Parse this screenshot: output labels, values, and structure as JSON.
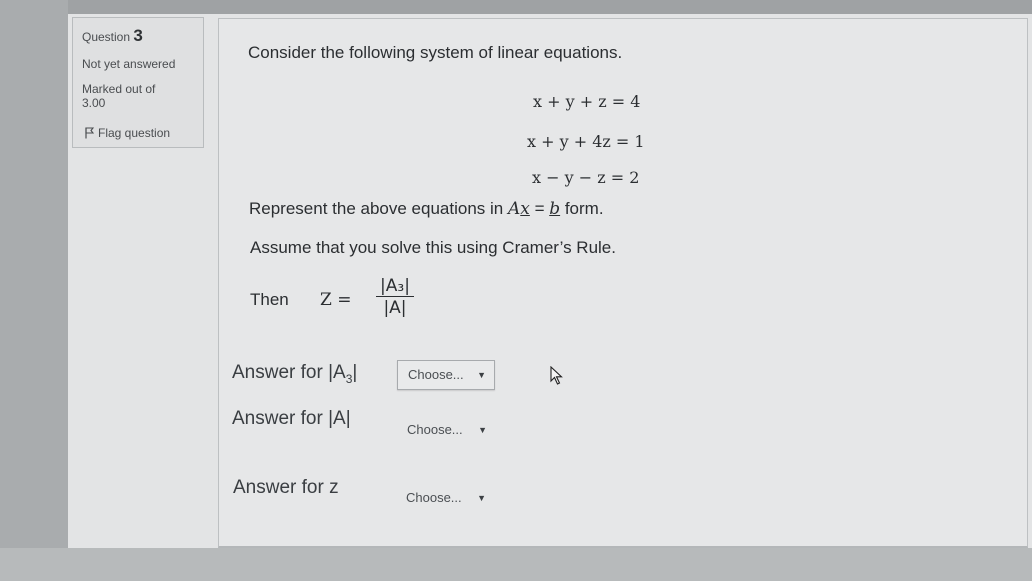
{
  "info": {
    "question_prefix": "Question",
    "question_number": "3",
    "state": "Not yet answered",
    "marked_out_of_label": "Marked out of",
    "marked_out_of_value": "3.00",
    "flag_label": "Flag question"
  },
  "question": {
    "intro": "Consider the following system of linear equations.",
    "equations": [
      "x + y + z = 4",
      "x + y + 4z = 1",
      "x − y − z = 2"
    ],
    "represent_prefix": "Represent the above equations in ",
    "represent_A": "A",
    "represent_x": "x",
    "represent_eq": " = ",
    "represent_b": "b",
    "represent_suffix": " form.",
    "assume": "Assume that you solve this using Cramer’s Rule.",
    "then_label": "Then",
    "z_var": "Z =",
    "frac_numerator": "|A₃|",
    "frac_denominator": "|A|"
  },
  "answers": [
    {
      "label_html_parts": [
        "Answer for |A",
        "3",
        "|"
      ],
      "select_value": "Choose..."
    },
    {
      "label": "Answer for |A|",
      "select_value": "Choose..."
    },
    {
      "label": "Answer for z",
      "select_value": "Choose..."
    }
  ],
  "icons": {
    "flag": "flag-icon",
    "dropdown": "triangle-down",
    "cursor": "mouse-pointer"
  }
}
